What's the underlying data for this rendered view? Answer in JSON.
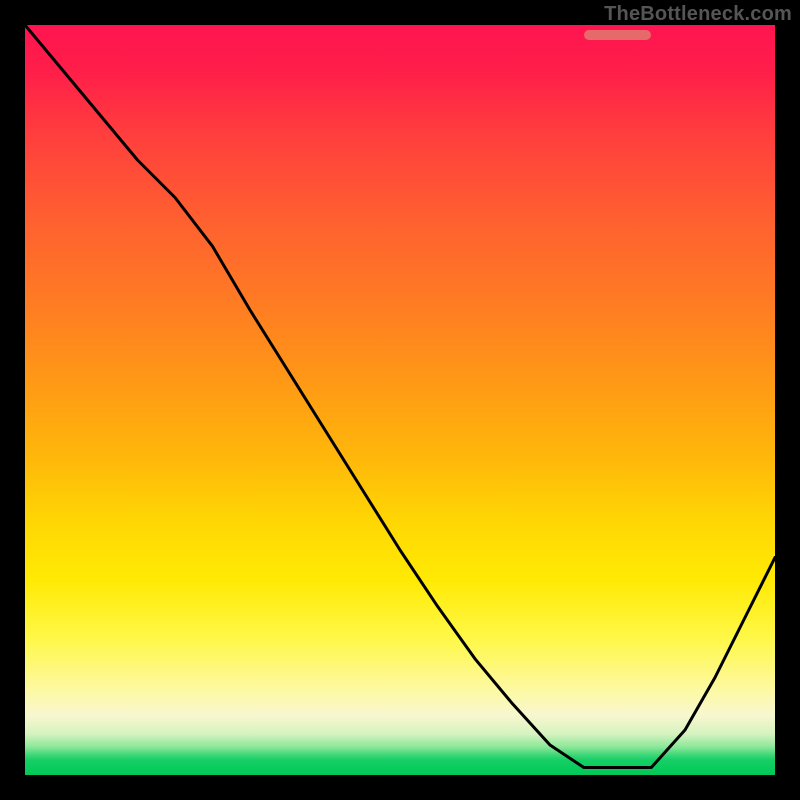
{
  "watermark": "TheBottleneck.com",
  "marker": {
    "x0": 0.745,
    "x1": 0.835,
    "y": 0.987
  },
  "chart_data": {
    "type": "line",
    "title": "",
    "xlabel": "",
    "ylabel": "",
    "xlim": [
      0,
      1
    ],
    "ylim": [
      0,
      1
    ],
    "series": [
      {
        "name": "curve",
        "x": [
          0.0,
          0.05,
          0.1,
          0.15,
          0.2,
          0.25,
          0.3,
          0.35,
          0.4,
          0.45,
          0.5,
          0.55,
          0.6,
          0.65,
          0.7,
          0.745,
          0.79,
          0.835,
          0.88,
          0.92,
          0.96,
          1.0
        ],
        "y": [
          1.0,
          0.94,
          0.88,
          0.82,
          0.77,
          0.705,
          0.62,
          0.54,
          0.46,
          0.38,
          0.3,
          0.225,
          0.155,
          0.095,
          0.04,
          0.01,
          0.01,
          0.01,
          0.06,
          0.13,
          0.21,
          0.29
        ]
      }
    ],
    "gradient_stops": [
      {
        "pos": 0.0,
        "color": "#ff1450"
      },
      {
        "pos": 0.26,
        "color": "#ff6030"
      },
      {
        "pos": 0.58,
        "color": "#ffb80a"
      },
      {
        "pos": 0.82,
        "color": "#fff84a"
      },
      {
        "pos": 0.95,
        "color": "#d6f3c0"
      },
      {
        "pos": 1.0,
        "color": "#02c857"
      }
    ]
  }
}
